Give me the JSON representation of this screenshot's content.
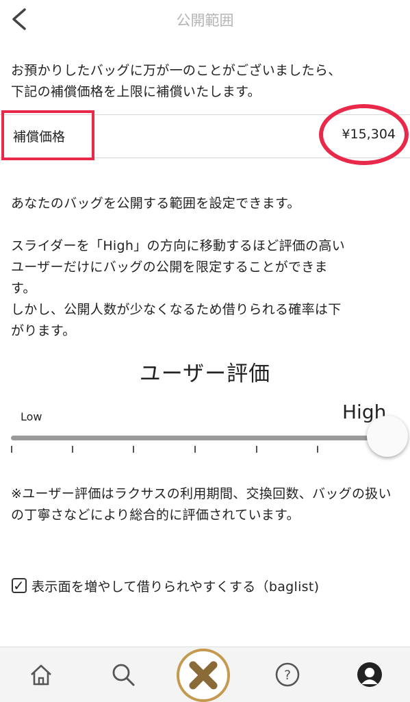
{
  "header": {
    "title": "公開範囲"
  },
  "intro": {
    "text": "お預かりしたバッグに万が一のことがございましたら、\n下記の補償価格を上限に補償いたします。"
  },
  "compensation": {
    "label": "補償価格",
    "value": "¥15,304"
  },
  "description": {
    "text1": "あなたのバッグを公開する範囲を設定できます。",
    "text2": "スライダーを「High」の方向に移動するほど評価の高い\nユーザーだけにバッグの公開を限定することができま\nす。\nしかし、公開人数が少なくなるため借りられる確率は下\nがります。"
  },
  "rating": {
    "title": "ユーザー評価",
    "low_label": "Low",
    "high_label": "High",
    "level": 1.0
  },
  "note": {
    "text": "※ユーザー評価はラクサスの利用期間、交換回数、バッグの扱いの丁寧さなどにより総合的に評価されています。"
  },
  "option": {
    "label": "表示面を増やして借りられやすくする（baglist)",
    "checked": true
  },
  "tabbar": {
    "items": [
      "home-icon",
      "search-icon",
      "laxus-x-logo",
      "help-icon",
      "profile-icon"
    ],
    "accent_color": "#c39a4f"
  },
  "colors": {
    "highlight": "#e8294a",
    "title": "#b5b5b5"
  }
}
